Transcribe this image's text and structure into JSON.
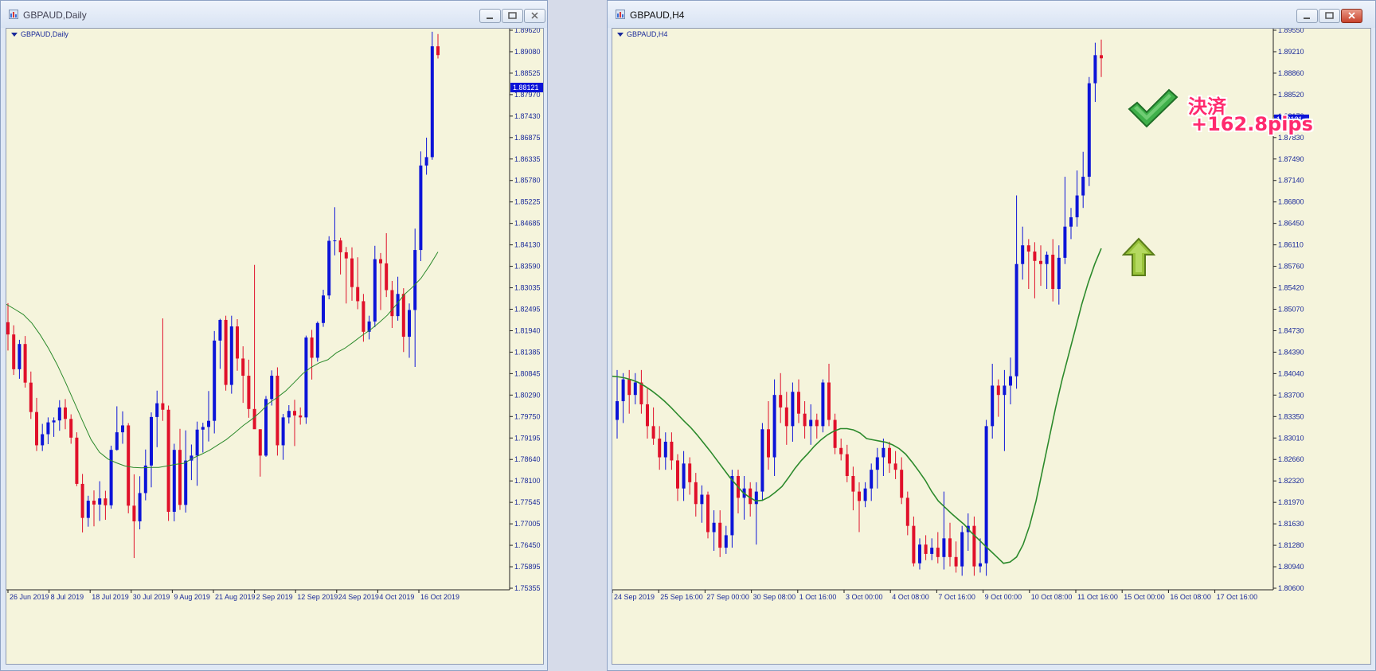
{
  "left_window": {
    "title": "GBPAUD,Daily",
    "chart_label": "GBPAUD,Daily"
  },
  "right_window": {
    "title": "GBPAUD,H4",
    "chart_label": "GBPAUD,H4"
  },
  "annotation": {
    "line1": "決済",
    "line2": "+162.8pips",
    "color": "#ff2a6e"
  },
  "colors": {
    "background": "#f5f4dc",
    "bull": "#0c14d8",
    "bear": "#e0102a",
    "ma": "#2c8a2c",
    "axis_text": "#1a2a9a",
    "price_tag": "#0c14d8"
  },
  "chart_data": [
    {
      "type": "candlestick",
      "symbol": "GBPAUD",
      "timeframe": "Daily",
      "title": "GBPAUD,Daily",
      "ylim": [
        1.7502,
        1.8962
      ],
      "y_ticks": [
        "1.89620",
        "1.89080",
        "1.88525",
        "1.87970",
        "1.87430",
        "1.86875",
        "1.86335",
        "1.85780",
        "1.85225",
        "1.84685",
        "1.84130",
        "1.83590",
        "1.83035",
        "1.82495",
        "1.81940",
        "1.81385",
        "1.80845",
        "1.80290",
        "1.79750",
        "1.79195",
        "1.78640",
        "1.78100",
        "1.77545",
        "1.77005",
        "1.76450",
        "1.75895",
        "1.75355"
      ],
      "x_ticks": [
        "26 Jun 2019",
        "8 Jul 2019",
        "18 Jul 2019",
        "30 Jul 2019",
        "9 Aug 2019",
        "21 Aug 2019",
        "2 Sep 2019",
        "12 Sep 2019",
        "24 Sep 2019",
        "4 Oct 2019",
        "16 Oct 2019"
      ],
      "current_price": "1.88121",
      "indicator": "moving average",
      "candles": [
        [
          1.8198,
          1.8248,
          1.8124,
          1.8166
        ],
        [
          1.8166,
          1.819,
          1.806,
          1.8075
        ],
        [
          1.8075,
          1.8152,
          1.805,
          1.8141
        ],
        [
          1.8141,
          1.8162,
          1.8027,
          1.804
        ],
        [
          1.804,
          1.8069,
          1.7945,
          1.7963
        ],
        [
          1.7963,
          1.8,
          1.7861,
          1.7876
        ],
        [
          1.7876,
          1.7932,
          1.7861,
          1.7905
        ],
        [
          1.7905,
          1.7949,
          1.7879,
          1.7936
        ],
        [
          1.7936,
          1.7949,
          1.7898,
          1.7941
        ],
        [
          1.7941,
          1.7994,
          1.7914,
          1.7975
        ],
        [
          1.7975,
          1.7997,
          1.7918,
          1.7945
        ],
        [
          1.7945,
          1.7957,
          1.788,
          1.7896
        ],
        [
          1.7896,
          1.791,
          1.7769,
          1.7775
        ],
        [
          1.7775,
          1.7801,
          1.7648,
          1.7686
        ],
        [
          1.7686,
          1.7744,
          1.7663,
          1.7731
        ],
        [
          1.7731,
          1.7758,
          1.7664,
          1.7721
        ],
        [
          1.7721,
          1.7782,
          1.7678,
          1.7737
        ],
        [
          1.7737,
          1.7757,
          1.7681,
          1.7719
        ],
        [
          1.7719,
          1.7875,
          1.771,
          1.7864
        ],
        [
          1.7864,
          1.7978,
          1.7862,
          1.791
        ],
        [
          1.791,
          1.7965,
          1.788,
          1.7928
        ],
        [
          1.7928,
          1.7934,
          1.7698,
          1.7718
        ],
        [
          1.7718,
          1.78,
          1.7581,
          1.7677
        ],
        [
          1.7677,
          1.7795,
          1.7656,
          1.7751
        ],
        [
          1.7751,
          1.7865,
          1.7732,
          1.7823
        ],
        [
          1.7823,
          1.7962,
          1.7766,
          1.795
        ],
        [
          1.795,
          1.8019,
          1.7871,
          1.7986
        ],
        [
          1.7986,
          1.8208,
          1.794,
          1.7969
        ],
        [
          1.7969,
          1.798,
          1.7678,
          1.7702
        ],
        [
          1.7702,
          1.788,
          1.7677,
          1.7864
        ],
        [
          1.7864,
          1.7919,
          1.7707,
          1.772
        ],
        [
          1.772,
          1.7915,
          1.77,
          1.7836
        ],
        [
          1.7836,
          1.7878,
          1.7785,
          1.7849
        ],
        [
          1.7849,
          1.7938,
          1.777,
          1.7917
        ],
        [
          1.7917,
          1.7935,
          1.7857,
          1.7924
        ],
        [
          1.7924,
          1.8018,
          1.7886,
          1.794
        ],
        [
          1.794,
          1.8175,
          1.7907,
          1.815
        ],
        [
          1.815,
          1.8207,
          1.8076,
          1.8204
        ],
        [
          1.8204,
          1.8215,
          1.8019,
          1.8034
        ],
        [
          1.8034,
          1.8215,
          1.8011,
          1.8187
        ],
        [
          1.8187,
          1.8206,
          1.8071,
          1.8103
        ],
        [
          1.8103,
          1.8135,
          1.7987,
          1.8058
        ],
        [
          1.8058,
          1.81,
          1.7948,
          1.7971
        ],
        [
          1.7971,
          1.8348,
          1.7971,
          1.7918
        ],
        [
          1.7918,
          1.7918,
          1.7794,
          1.7849
        ],
        [
          1.7849,
          1.8005,
          1.7846,
          1.7997
        ],
        [
          1.7997,
          1.8072,
          1.798,
          1.8058
        ],
        [
          1.8058,
          1.808,
          1.7849,
          1.7876
        ],
        [
          1.7876,
          1.7958,
          1.7838,
          1.7949
        ],
        [
          1.7949,
          1.7981,
          1.7933,
          1.7966
        ],
        [
          1.7966,
          1.7995,
          1.7874,
          1.7954
        ],
        [
          1.7954,
          1.7975,
          1.793,
          1.7949
        ],
        [
          1.7949,
          1.8163,
          1.7932,
          1.8158
        ],
        [
          1.8158,
          1.8178,
          1.8048,
          1.8105
        ],
        [
          1.8105,
          1.82,
          1.8095,
          1.8196
        ],
        [
          1.8196,
          1.8283,
          1.8186,
          1.8268
        ],
        [
          1.8268,
          1.8423,
          1.8258,
          1.8411
        ],
        [
          1.8411,
          1.8499,
          1.8373,
          1.8412
        ],
        [
          1.8412,
          1.8419,
          1.8323,
          1.8381
        ],
        [
          1.8381,
          1.8395,
          1.8247,
          1.8365
        ],
        [
          1.8365,
          1.8394,
          1.8254,
          1.829
        ],
        [
          1.829,
          1.8368,
          1.8232,
          1.8253
        ],
        [
          1.8253,
          1.8272,
          1.8147,
          1.8173
        ],
        [
          1.8173,
          1.8215,
          1.8153,
          1.82
        ],
        [
          1.82,
          1.8398,
          1.8185,
          1.8363
        ],
        [
          1.8363,
          1.8379,
          1.823,
          1.8352
        ],
        [
          1.8352,
          1.8431,
          1.8264,
          1.8282
        ],
        [
          1.8282,
          1.8306,
          1.8183,
          1.8214
        ],
        [
          1.8214,
          1.8317,
          1.8202,
          1.8272
        ],
        [
          1.8272,
          1.8287,
          1.812,
          1.816
        ],
        [
          1.816,
          1.8247,
          1.8105,
          1.823
        ],
        [
          1.823,
          1.8443,
          1.8081,
          1.8387
        ],
        [
          1.8387,
          1.8645,
          1.8358,
          1.8608
        ],
        [
          1.8608,
          1.8681,
          1.8584,
          1.863
        ],
        [
          1.863,
          1.8958,
          1.8623,
          1.892
        ],
        [
          1.892,
          1.8952,
          1.8888,
          1.8897
        ]
      ],
      "ma": [
        1.8245,
        1.8232,
        1.8218,
        1.8196,
        1.8165,
        1.8129,
        1.8087,
        1.804,
        1.799,
        1.794,
        1.7891,
        1.7858,
        1.784,
        1.783,
        1.7822,
        1.7818,
        1.7817,
        1.7818,
        1.7818,
        1.7822,
        1.7826,
        1.7829,
        1.7842,
        1.7852,
        1.7863,
        1.7877,
        1.7891,
        1.7909,
        1.7928,
        1.7944,
        1.7963,
        1.7986,
        1.8001,
        1.8018,
        1.804,
        1.8063,
        1.808,
        1.8092,
        1.81,
        1.8118,
        1.813,
        1.8146,
        1.8163,
        1.8178,
        1.8196,
        1.8216,
        1.8242,
        1.827,
        1.829,
        1.8313,
        1.8346,
        1.8382
      ]
    },
    {
      "type": "candlestick",
      "symbol": "GBPAUD",
      "timeframe": "H4",
      "title": "GBPAUD,H4",
      "ylim": [
        1.806,
        1.8955
      ],
      "y_ticks": [
        "1.89550",
        "1.89210",
        "1.88860",
        "1.88520",
        "1.88170",
        "1.87830",
        "1.87490",
        "1.87140",
        "1.86800",
        "1.86450",
        "1.86110",
        "1.85760",
        "1.85420",
        "1.85070",
        "1.84730",
        "1.84390",
        "1.84040",
        "1.83700",
        "1.83350",
        "1.83010",
        "1.82660",
        "1.82320",
        "1.81970",
        "1.81630",
        "1.81280",
        "1.80940",
        "1.80600"
      ],
      "x_ticks": [
        "24 Sep 2019",
        "25 Sep 16:00",
        "27 Sep 00:00",
        "30 Sep 08:00",
        "1 Oct 16:00",
        "3 Oct 00:00",
        "4 Oct 08:00",
        "7 Oct 16:00",
        "9 Oct 00:00",
        "10 Oct 08:00",
        "11 Oct 16:00",
        "15 Oct 00:00",
        "16 Oct 08:00",
        "17 Oct 16:00"
      ],
      "current_price": "1.88121",
      "indicator": "moving average",
      "candles": [
        [
          1.833,
          1.841,
          1.83,
          1.836
        ],
        [
          1.836,
          1.8405,
          1.8325,
          1.8395
        ],
        [
          1.8395,
          1.841,
          1.834,
          1.837
        ],
        [
          1.837,
          1.8405,
          1.8355,
          1.839
        ],
        [
          1.839,
          1.841,
          1.834,
          1.8355
        ],
        [
          1.8355,
          1.838,
          1.83,
          1.832
        ],
        [
          1.832,
          1.835,
          1.829,
          1.83
        ],
        [
          1.83,
          1.832,
          1.825,
          1.827
        ],
        [
          1.827,
          1.831,
          1.825,
          1.8295
        ],
        [
          1.8295,
          1.831,
          1.825,
          1.8265
        ],
        [
          1.8265,
          1.8275,
          1.82,
          1.822
        ],
        [
          1.822,
          1.828,
          1.82,
          1.826
        ],
        [
          1.826,
          1.827,
          1.821,
          1.823
        ],
        [
          1.823,
          1.8245,
          1.8175,
          1.8195
        ],
        [
          1.8195,
          1.8225,
          1.8165,
          1.821
        ],
        [
          1.821,
          1.8215,
          1.814,
          1.815
        ],
        [
          1.815,
          1.8185,
          1.812,
          1.8165
        ],
        [
          1.8165,
          1.8185,
          1.811,
          1.8125
        ],
        [
          1.8125,
          1.816,
          1.8115,
          1.8145
        ],
        [
          1.8145,
          1.825,
          1.8125,
          1.824
        ],
        [
          1.824,
          1.825,
          1.818,
          1.8205
        ],
        [
          1.8205,
          1.824,
          1.817,
          1.822
        ],
        [
          1.822,
          1.823,
          1.8175,
          1.8195
        ],
        [
          1.8195,
          1.823,
          1.813,
          1.8215
        ],
        [
          1.8215,
          1.8325,
          1.82,
          1.8315
        ],
        [
          1.8315,
          1.836,
          1.825,
          1.827
        ],
        [
          1.827,
          1.8395,
          1.824,
          1.837
        ],
        [
          1.837,
          1.8405,
          1.8325,
          1.835
        ],
        [
          1.835,
          1.8375,
          1.829,
          1.832
        ],
        [
          1.832,
          1.839,
          1.8295,
          1.8375
        ],
        [
          1.8375,
          1.8395,
          1.8325,
          1.834
        ],
        [
          1.834,
          1.836,
          1.83,
          1.832
        ],
        [
          1.832,
          1.8355,
          1.829,
          1.833
        ],
        [
          1.833,
          1.834,
          1.83,
          1.832
        ],
        [
          1.832,
          1.8395,
          1.831,
          1.839
        ],
        [
          1.839,
          1.842,
          1.832,
          1.833
        ],
        [
          1.833,
          1.834,
          1.8275,
          1.8285
        ],
        [
          1.8285,
          1.83,
          1.8265,
          1.8275
        ],
        [
          1.8275,
          1.829,
          1.823,
          1.824
        ],
        [
          1.824,
          1.8255,
          1.8185,
          1.8215
        ],
        [
          1.8215,
          1.823,
          1.815,
          1.82
        ],
        [
          1.82,
          1.823,
          1.819,
          1.822
        ],
        [
          1.822,
          1.826,
          1.82,
          1.825
        ],
        [
          1.825,
          1.8285,
          1.822,
          1.827
        ],
        [
          1.827,
          1.83,
          1.824,
          1.8285
        ],
        [
          1.8285,
          1.8295,
          1.8245,
          1.826
        ],
        [
          1.826,
          1.828,
          1.8235,
          1.825
        ],
        [
          1.825,
          1.827,
          1.8195,
          1.8205
        ],
        [
          1.8205,
          1.8215,
          1.8145,
          1.816
        ],
        [
          1.816,
          1.8175,
          1.8095,
          1.81
        ],
        [
          1.81,
          1.814,
          1.809,
          1.813
        ],
        [
          1.813,
          1.8145,
          1.8105,
          1.8115
        ],
        [
          1.8115,
          1.814,
          1.8105,
          1.8125
        ],
        [
          1.8125,
          1.815,
          1.81,
          1.811
        ],
        [
          1.811,
          1.8215,
          1.809,
          1.814
        ],
        [
          1.814,
          1.8165,
          1.8095,
          1.811
        ],
        [
          1.811,
          1.8135,
          1.8085,
          1.8095
        ],
        [
          1.8095,
          1.816,
          1.808,
          1.815
        ],
        [
          1.815,
          1.818,
          1.812,
          1.816
        ],
        [
          1.816,
          1.8175,
          1.808,
          1.8095
        ],
        [
          1.8095,
          1.814,
          1.8085,
          1.81
        ],
        [
          1.81,
          1.833,
          1.808,
          1.832
        ],
        [
          1.832,
          1.842,
          1.83,
          1.8385
        ],
        [
          1.8385,
          1.8395,
          1.8335,
          1.837
        ],
        [
          1.837,
          1.841,
          1.828,
          1.8385
        ],
        [
          1.8385,
          1.843,
          1.8355,
          1.84
        ],
        [
          1.84,
          1.869,
          1.838,
          1.858
        ],
        [
          1.858,
          1.864,
          1.8555,
          1.861
        ],
        [
          1.861,
          1.862,
          1.854,
          1.86
        ],
        [
          1.86,
          1.8615,
          1.8525,
          1.8585
        ],
        [
          1.8585,
          1.861,
          1.8545,
          1.858
        ],
        [
          1.858,
          1.86,
          1.854,
          1.8595
        ],
        [
          1.8595,
          1.862,
          1.852,
          1.854
        ],
        [
          1.854,
          1.861,
          1.8515,
          1.859
        ],
        [
          1.859,
          1.872,
          1.858,
          1.864
        ],
        [
          1.864,
          1.867,
          1.862,
          1.8655
        ],
        [
          1.8655,
          1.873,
          1.864,
          1.869
        ],
        [
          1.869,
          1.876,
          1.867,
          1.872
        ],
        [
          1.872,
          1.888,
          1.8705,
          1.887
        ],
        [
          1.887,
          1.8935,
          1.884,
          1.8915
        ],
        [
          1.8915,
          1.894,
          1.888,
          1.891
        ]
      ],
      "ma": [
        1.84,
        1.8399,
        1.8397,
        1.8394,
        1.839,
        1.8384,
        1.8377,
        1.8369,
        1.836,
        1.835,
        1.8339,
        1.8328,
        1.8318,
        1.8306,
        1.8293,
        1.828,
        1.8266,
        1.8252,
        1.8238,
        1.8226,
        1.8214,
        1.8206,
        1.82,
        1.8201,
        1.8206,
        1.8214,
        1.8223,
        1.8237,
        1.8252,
        1.8265,
        1.8276,
        1.8288,
        1.8298,
        1.8306,
        1.8312,
        1.8316,
        1.8316,
        1.8314,
        1.8309,
        1.83,
        1.8298,
        1.8296,
        1.8294,
        1.829,
        1.8284,
        1.8275,
        1.8262,
        1.8248,
        1.8233,
        1.8215,
        1.82,
        1.819,
        1.818,
        1.8171,
        1.8162,
        1.815,
        1.814,
        1.813,
        1.812,
        1.811,
        1.81,
        1.8102,
        1.811,
        1.813,
        1.816,
        1.82,
        1.825,
        1.83,
        1.835,
        1.8395,
        1.8435,
        1.8475,
        1.8515,
        1.855,
        1.858,
        1.8605
      ]
    }
  ]
}
